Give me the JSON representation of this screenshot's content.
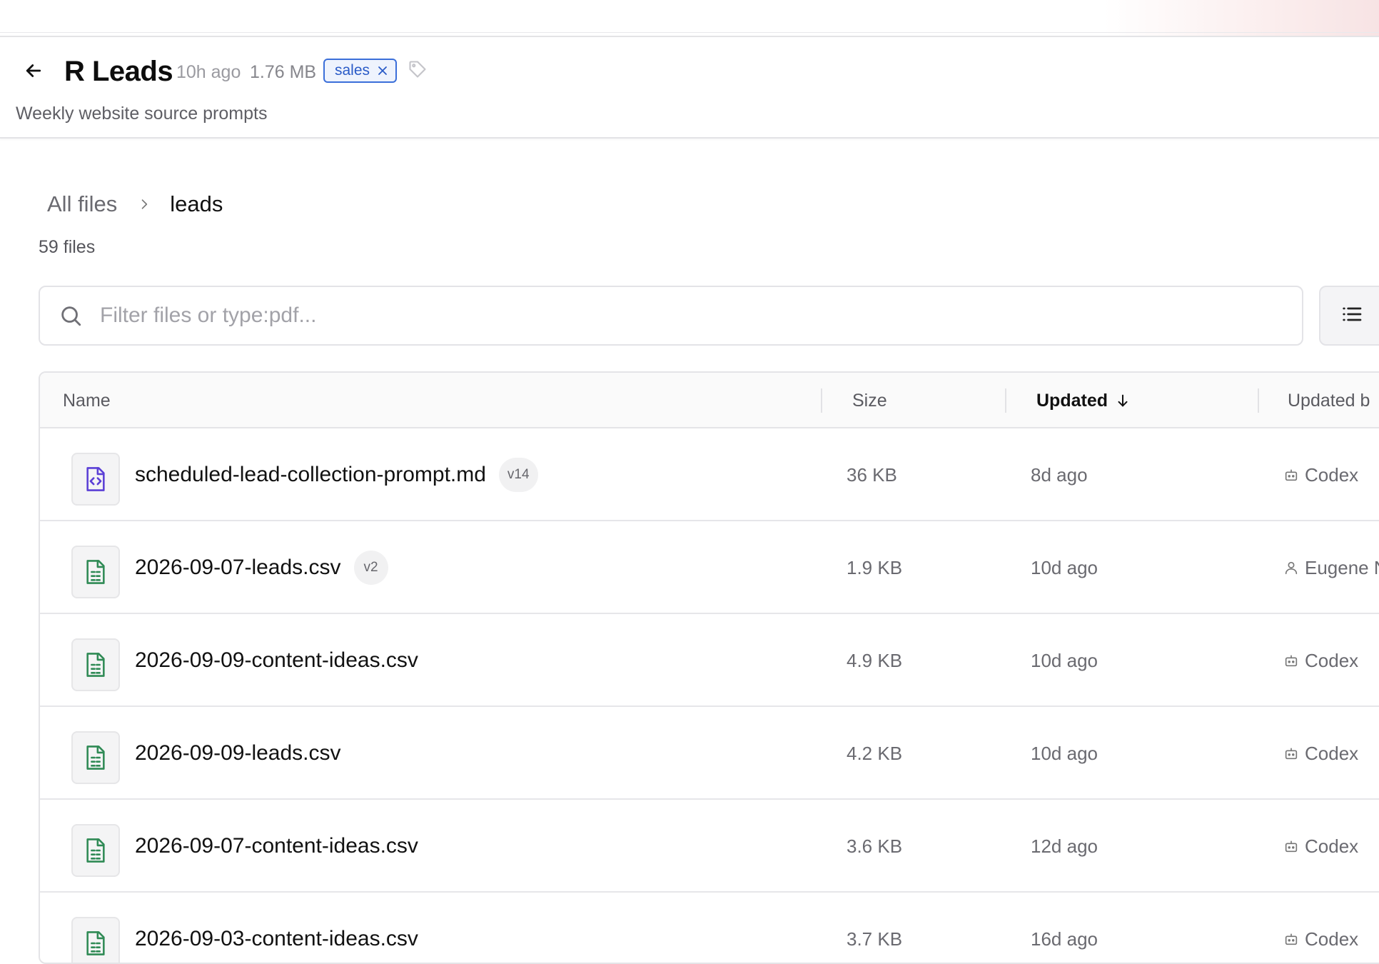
{
  "header": {
    "title": "R Leads",
    "updated": "10h ago",
    "size": "1.76 MB",
    "tag": "sales",
    "subtitle": "Weekly website source prompts"
  },
  "breadcrumb": {
    "root": "All files",
    "current": "leads"
  },
  "file_count": "59 files",
  "search": {
    "placeholder": "Filter files or type:pdf..."
  },
  "table": {
    "columns": {
      "name": "Name",
      "size": "Size",
      "updated": "Updated",
      "updated_by": "Updated b"
    },
    "rows": [
      {
        "name": "scheduled-lead-collection-prompt.md",
        "version": "v14",
        "size": "36 KB",
        "updated": "8d ago",
        "updated_by": "Codex",
        "by_type": "bot",
        "file_type": "markdown"
      },
      {
        "name": "2026-09-07-leads.csv",
        "version": "v2",
        "size": "1.9 KB",
        "updated": "10d ago",
        "updated_by": "Eugene N",
        "by_type": "user",
        "file_type": "csv"
      },
      {
        "name": "2026-09-09-content-ideas.csv",
        "version": "",
        "size": "4.9 KB",
        "updated": "10d ago",
        "updated_by": "Codex",
        "by_type": "bot",
        "file_type": "csv"
      },
      {
        "name": "2026-09-09-leads.csv",
        "version": "",
        "size": "4.2 KB",
        "updated": "10d ago",
        "updated_by": "Codex",
        "by_type": "bot",
        "file_type": "csv"
      },
      {
        "name": "2026-09-07-content-ideas.csv",
        "version": "",
        "size": "3.6 KB",
        "updated": "12d ago",
        "updated_by": "Codex",
        "by_type": "bot",
        "file_type": "csv"
      },
      {
        "name": "2026-09-03-content-ideas.csv",
        "version": "",
        "size": "3.7 KB",
        "updated": "16d ago",
        "updated_by": "Codex",
        "by_type": "bot",
        "file_type": "csv"
      }
    ]
  },
  "colors": {
    "tag_border": "#3b6fd9",
    "md_icon": "#5b3fd6",
    "csv_icon": "#2f8a55"
  },
  "icons": [
    "arrow-left-icon",
    "close-icon",
    "tag-icon",
    "chevron-right-icon",
    "search-icon",
    "list-view-icon",
    "arrow-down-icon",
    "markdown-file-icon",
    "csv-file-icon",
    "bot-icon",
    "user-icon"
  ]
}
